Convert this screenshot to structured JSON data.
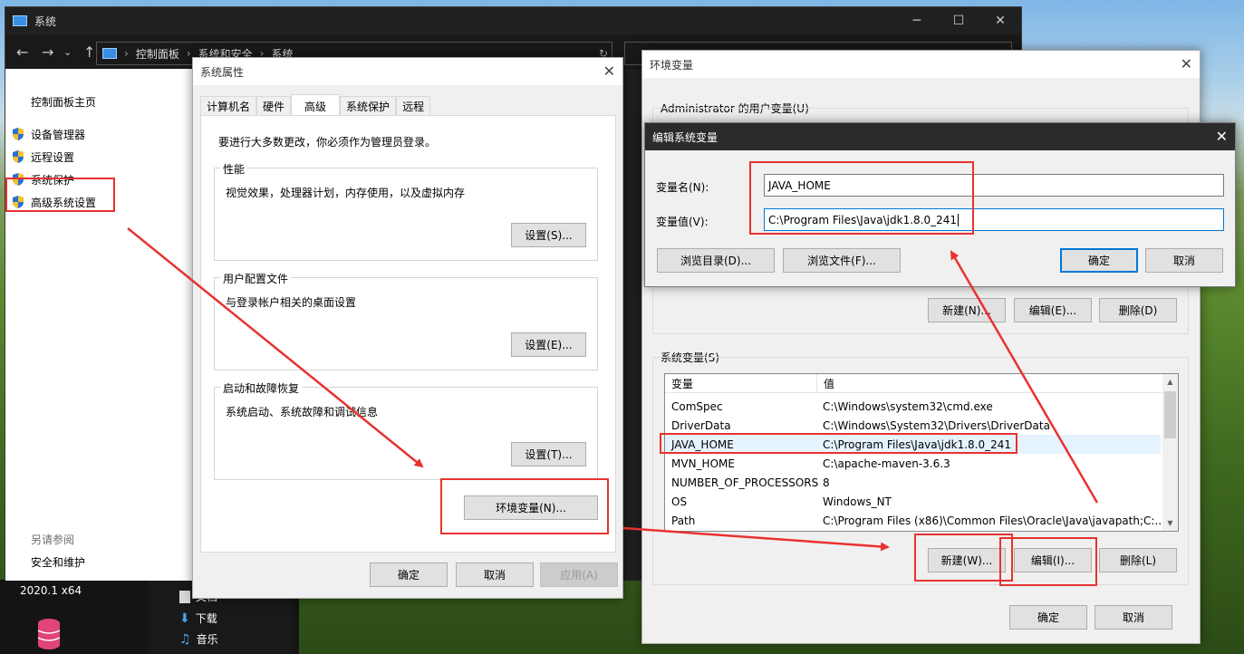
{
  "desktop": {
    "items": [
      {
        "label": "2020.1 x64"
      },
      {
        "label": "文档"
      },
      {
        "label": "下载"
      },
      {
        "label": "音乐"
      }
    ]
  },
  "explorer": {
    "title": "系统",
    "breadcrumb": [
      "控制面板",
      "系统和安全",
      "系统"
    ],
    "left_home": "控制面板主页",
    "left_links": [
      "设备管理器",
      "远程设置",
      "系统保护",
      "高级系统设置"
    ],
    "see_also_title": "另请参阅",
    "see_also_link": "安全和维护"
  },
  "sysprops": {
    "title": "系统属性",
    "tabs": [
      "计算机名",
      "硬件",
      "高级",
      "系统保护",
      "远程"
    ],
    "admin_note": "要进行大多数更改，你必须作为管理员登录。",
    "perf_title": "性能",
    "perf_desc": "视觉效果，处理器计划，内存使用，以及虚拟内存",
    "perf_btn": "设置(S)...",
    "profile_title": "用户配置文件",
    "profile_desc": "与登录帐户相关的桌面设置",
    "profile_btn": "设置(E)...",
    "startup_title": "启动和故障恢复",
    "startup_desc": "系统启动、系统故障和调试信息",
    "startup_btn": "设置(T)...",
    "env_btn": "环境变量(N)...",
    "ok": "确定",
    "cancel": "取消",
    "apply": "应用(A)"
  },
  "envvars": {
    "title": "环境变量",
    "user_vars_title": "Administrator 的用户变量(U)",
    "user_new": "新建(N)...",
    "user_edit": "编辑(E)...",
    "user_delete": "删除(D)",
    "sys_vars_title": "系统变量(S)",
    "col_var": "变量",
    "col_val": "值",
    "rows": [
      {
        "name": "ComSpec",
        "value": "C:\\Windows\\system32\\cmd.exe"
      },
      {
        "name": "DriverData",
        "value": "C:\\Windows\\System32\\Drivers\\DriverData"
      },
      {
        "name": "JAVA_HOME",
        "value": "C:\\Program Files\\Java\\jdk1.8.0_241"
      },
      {
        "name": "MVN_HOME",
        "value": "C:\\apache-maven-3.6.3"
      },
      {
        "name": "NUMBER_OF_PROCESSORS",
        "value": "8"
      },
      {
        "name": "OS",
        "value": "Windows_NT"
      },
      {
        "name": "Path",
        "value": "C:\\Program Files (x86)\\Common Files\\Oracle\\Java\\javapath;C:..."
      }
    ],
    "sys_new": "新建(W)...",
    "sys_edit": "编辑(I)...",
    "sys_delete": "删除(L)",
    "ok": "确定",
    "cancel": "取消"
  },
  "editvar": {
    "title": "编辑系统变量",
    "name_label": "变量名(N):",
    "name_value": "JAVA_HOME",
    "value_label": "变量值(V):",
    "value_value": "C:\\Program Files\\Java\\jdk1.8.0_241",
    "browse_dir": "浏览目录(D)...",
    "browse_file": "浏览文件(F)...",
    "ok": "确定",
    "cancel": "取消"
  },
  "colors": {
    "annotation_red": "#e8322f",
    "focus_blue": "#0078d7",
    "selected_row": "#e5f3ff"
  }
}
